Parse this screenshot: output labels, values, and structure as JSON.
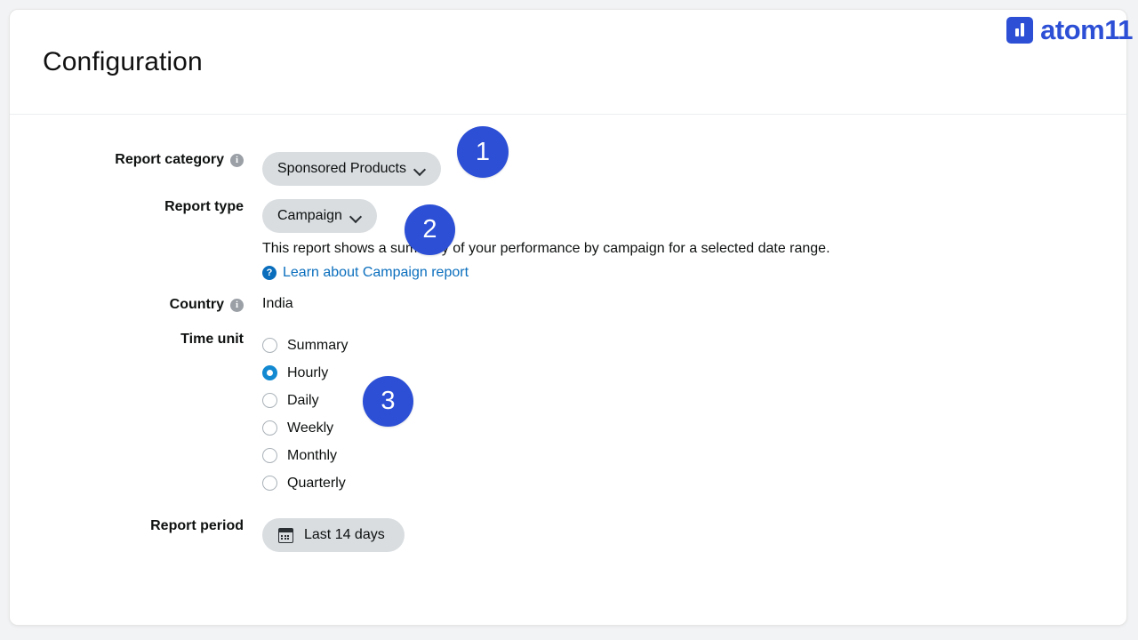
{
  "brand": {
    "name": "atom11",
    "mark_icon": "bar-chart-mark-icon",
    "color": "#2c4fd6"
  },
  "header": {
    "title": "Configuration"
  },
  "form": {
    "report_category": {
      "label": "Report category",
      "info_icon": "info-icon",
      "value": "Sponsored Products",
      "chevron_icon": "chevron-down-icon"
    },
    "report_type": {
      "label": "Report type",
      "value": "Campaign",
      "chevron_icon": "chevron-down-icon",
      "description": "This report shows a summary of your performance by campaign for a selected date range.",
      "help_link": "Learn about Campaign report",
      "help_icon": "question-circle-icon",
      "help_link_color": "#0a6ebd"
    },
    "country": {
      "label": "Country",
      "info_icon": "info-icon",
      "value": "India"
    },
    "time_unit": {
      "label": "Time unit",
      "selected": "Hourly",
      "selected_color": "#1389d1",
      "options": [
        {
          "label": "Summary",
          "selected": false
        },
        {
          "label": "Hourly",
          "selected": true
        },
        {
          "label": "Daily",
          "selected": false
        },
        {
          "label": "Weekly",
          "selected": false
        },
        {
          "label": "Monthly",
          "selected": false
        },
        {
          "label": "Quarterly",
          "selected": false
        }
      ]
    },
    "report_period": {
      "label": "Report period",
      "value": "Last 14 days",
      "calendar_icon": "calendar-icon"
    }
  },
  "step_badges": [
    {
      "number": "1",
      "target": "report-category-dropdown"
    },
    {
      "number": "2",
      "target": "report-type-dropdown"
    },
    {
      "number": "3",
      "target": "time-unit-hourly-radio"
    }
  ]
}
